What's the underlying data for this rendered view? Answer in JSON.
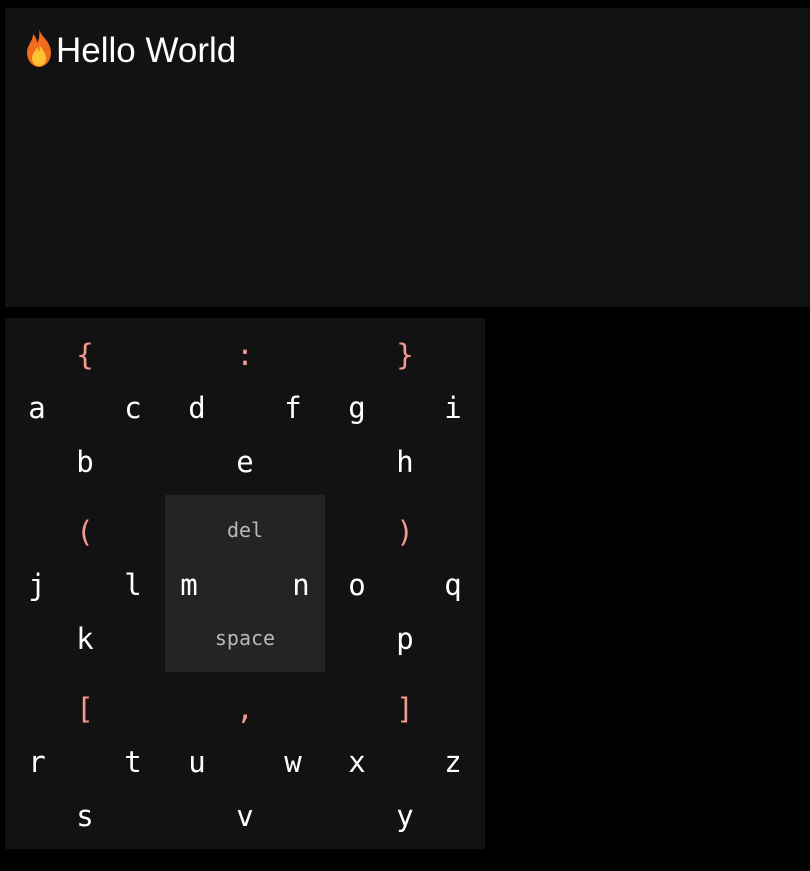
{
  "editor": {
    "text": "Hello World",
    "icon": "flame-icon"
  },
  "keyboard": {
    "blocks": [
      {
        "id": "block-1",
        "symbols": {
          "top_left": "{",
          "top_center": ":",
          "top_right": "}"
        },
        "row1": [
          "a",
          "c",
          "d",
          "f",
          "g",
          "i"
        ],
        "row2": [
          "b",
          "e",
          "h"
        ]
      },
      {
        "id": "block-2",
        "symbols": {
          "top_left": "(",
          "top_right": ")"
        },
        "row1": [
          "j",
          "l",
          "m",
          "n",
          "o",
          "q"
        ],
        "row2": [
          "k",
          "p"
        ]
      },
      {
        "id": "block-3",
        "symbols": {
          "top_left": "[",
          "top_center": ",",
          "top_right": "]"
        },
        "row1": [
          "r",
          "t",
          "u",
          "w",
          "x",
          "z"
        ],
        "row2": [
          "s",
          "v",
          "y"
        ]
      }
    ],
    "actions": {
      "delete_label": "del",
      "space_label": "space"
    }
  },
  "colors": {
    "background": "#000000",
    "panel": "#121212",
    "center_pad": "#242424",
    "letter": "#ffffff",
    "symbol": "#f59990",
    "action": "#b8b8b8"
  }
}
